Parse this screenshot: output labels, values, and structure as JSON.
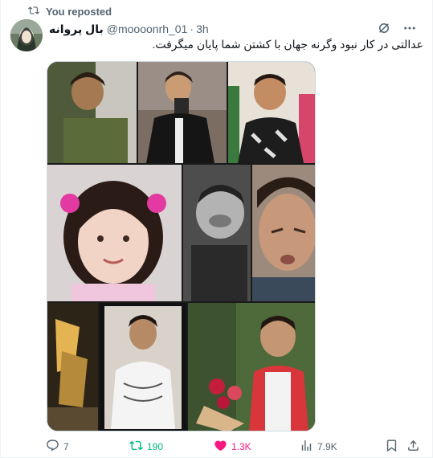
{
  "repost": {
    "label": "You reposted",
    "icon": "repost-icon"
  },
  "author": {
    "display_name": "بال پروانه",
    "handle": "@moooonrh_01",
    "separator": "·",
    "time": "3h"
  },
  "header_icons": [
    "grok-icon",
    "more-icon"
  ],
  "tweet": {
    "text": "عدالتی در کار نبود وگرنه جهان با کشتن شما پایان میگرفت."
  },
  "media": {
    "photos": [
      "photo-1",
      "photo-2",
      "photo-3",
      "photo-4",
      "photo-5",
      "photo-6",
      "photo-7",
      "photo-8",
      "photo-9"
    ]
  },
  "actions": {
    "reply": {
      "count": "7",
      "icon": "reply-icon"
    },
    "repost": {
      "count": "190",
      "icon": "repost-icon",
      "color": "#00ba7c"
    },
    "like": {
      "count": "1.3K",
      "icon": "heart-icon",
      "color": "#f91880"
    },
    "views": {
      "count": "7.9K",
      "icon": "views-icon"
    },
    "bookmark": {
      "icon": "bookmark-icon"
    },
    "share": {
      "icon": "share-icon"
    }
  },
  "colors": {
    "muted": "#536471",
    "text": "#0f1419",
    "green": "#00ba7c",
    "pink": "#f91880"
  }
}
